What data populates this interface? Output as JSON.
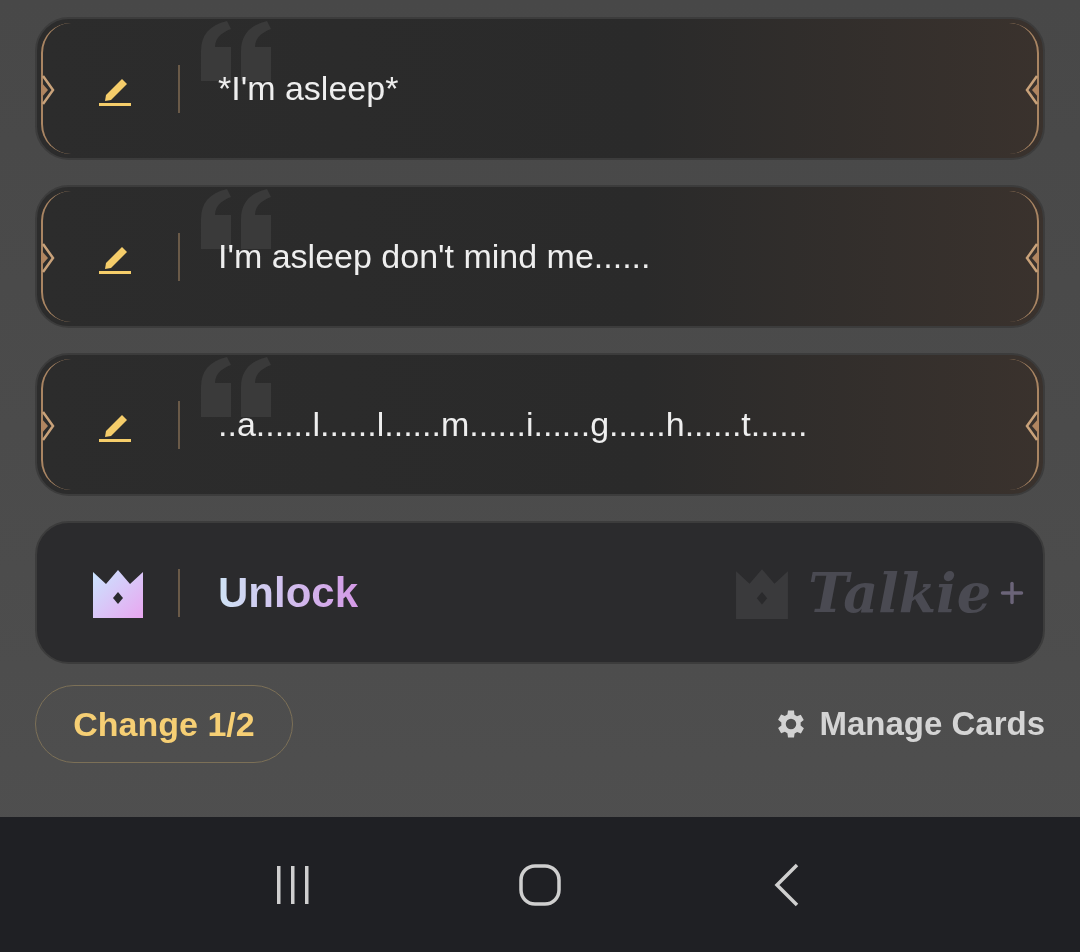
{
  "cards": [
    {
      "kind": "quote",
      "text": "*I'm asleep*"
    },
    {
      "kind": "quote",
      "text": "I'm asleep don't mind me......"
    },
    {
      "kind": "quote",
      "text": "..a......l......l......m......i......g......h......t......"
    },
    {
      "kind": "unlock",
      "text": "Unlock",
      "logo": "Talkie"
    }
  ],
  "change_button": "Change 1/2",
  "manage_button": "Manage Cards"
}
